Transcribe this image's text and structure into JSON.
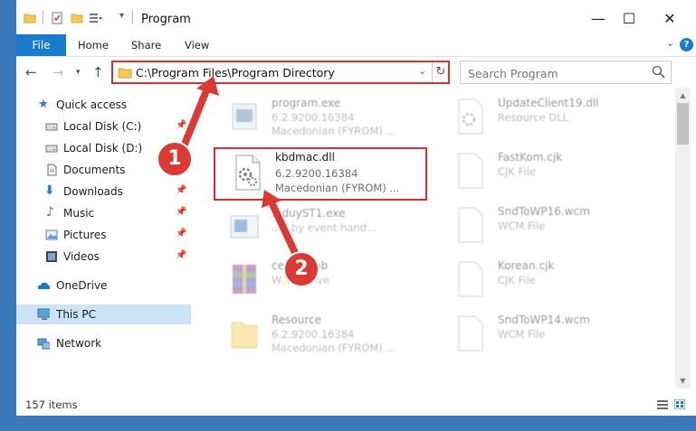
{
  "window": {
    "title": "Program"
  },
  "ribbon": {
    "tabs": [
      "File",
      "Home",
      "Share",
      "View"
    ]
  },
  "address": {
    "path": "C:\\Program Files\\Program Directory"
  },
  "search": {
    "placeholder": "Search Program"
  },
  "sidebar": {
    "items": [
      {
        "label": "Quick access",
        "icon": "star-icon"
      },
      {
        "label": "Local Disk (C:)",
        "icon": "drive-icon"
      },
      {
        "label": "Local Disk (D:)",
        "icon": "drive-icon"
      },
      {
        "label": "Documents",
        "icon": "documents-icon"
      },
      {
        "label": "Downloads",
        "icon": "download-icon"
      },
      {
        "label": "Music",
        "icon": "music-icon"
      },
      {
        "label": "Pictures",
        "icon": "pictures-icon"
      },
      {
        "label": "Videos",
        "icon": "videos-icon"
      },
      {
        "label": "OneDrive",
        "icon": "cloud-icon"
      },
      {
        "label": "This PC",
        "icon": "computer-icon"
      },
      {
        "label": "Network",
        "icon": "network-icon"
      }
    ]
  },
  "files": [
    {
      "name": "program.exe",
      "line1": "6.2.9200.16384",
      "line2": "Macedonian (FYROM) ..."
    },
    {
      "name": "kbdmac.dll",
      "line1": "6.2.9200.16384",
      "line2": "Macedonian (FYROM) ..."
    },
    {
      "name": "...duyST1.exe",
      "line1": "...d by event hand...",
      "line2": ""
    },
    {
      "name": "ce.......cab",
      "line1": "W...Archive",
      "line2": ""
    },
    {
      "name": "Resource",
      "line1": "6.2.9200.16384",
      "line2": "Macedonian (FYROM) ..."
    },
    {
      "name": "UpdateClient19.dll",
      "line1": "Resource DLL",
      "line2": ""
    },
    {
      "name": "FastKom.cjk",
      "line1": "CJK File",
      "line2": ""
    },
    {
      "name": "SndToWP16.wcm",
      "line1": "WCM File",
      "line2": ""
    },
    {
      "name": "Korean.cjk",
      "line1": "CJK File",
      "line2": ""
    },
    {
      "name": "SndToWP14.wcm",
      "line1": "WCM File",
      "line2": ""
    }
  ],
  "status": {
    "items_count": "157 items"
  },
  "callouts": {
    "one": "1",
    "two": "2"
  },
  "colors": {
    "accent": "#1979ca",
    "highlight": "#d9302c",
    "selected": "#cce4f7"
  }
}
